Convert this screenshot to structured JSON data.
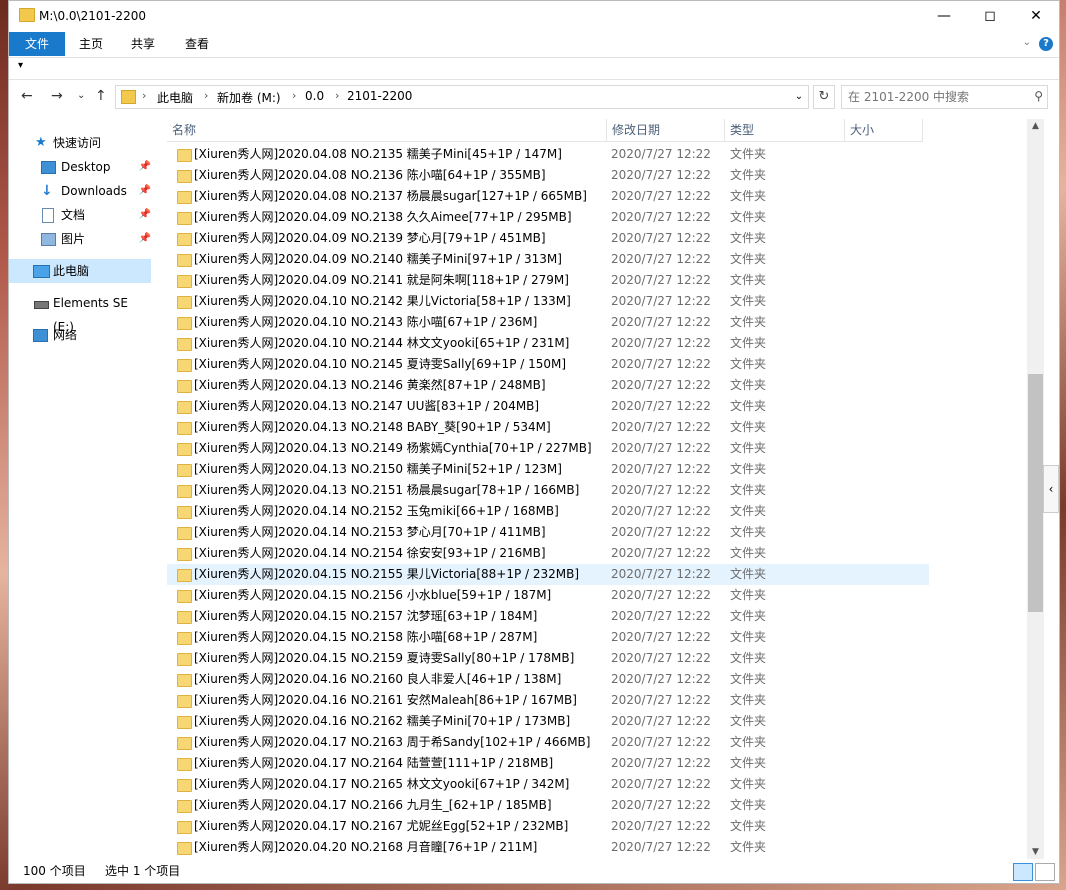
{
  "window": {
    "title": "M:\\0.0\\2101-2200"
  },
  "ribbon": {
    "tabs": [
      "文件",
      "主页",
      "共享",
      "查看"
    ]
  },
  "address": {
    "crumbs": [
      "此电脑",
      "新加卷 (M:)",
      "0.0",
      "2101-2200"
    ]
  },
  "search": {
    "placeholder": "在 2101-2200 中搜索"
  },
  "sidebar": {
    "items": [
      {
        "label": "快速访问",
        "icon": "star-icon"
      },
      {
        "label": "Desktop",
        "icon": "desktop-icon",
        "pinned": true
      },
      {
        "label": "Downloads",
        "icon": "download-icon",
        "pinned": true
      },
      {
        "label": "文档",
        "icon": "document-icon",
        "pinned": true
      },
      {
        "label": "图片",
        "icon": "picture-icon",
        "pinned": true
      },
      {
        "label": "此电脑",
        "icon": "computer-icon",
        "selected": true
      },
      {
        "label": "Elements SE (E:)",
        "icon": "drive-icon"
      },
      {
        "label": "网络",
        "icon": "network-icon"
      }
    ]
  },
  "columns": {
    "name": "名称",
    "date": "修改日期",
    "type": "类型",
    "size": "大小"
  },
  "files": [
    {
      "name": "[Xiuren秀人网]2020.04.08 NO.2135 糯美子Mini[45+1P / 147M]",
      "date": "2020/7/27 12:22",
      "type": "文件夹"
    },
    {
      "name": "[Xiuren秀人网]2020.04.08 NO.2136 陈小喵[64+1P / 355MB]",
      "date": "2020/7/27 12:22",
      "type": "文件夹"
    },
    {
      "name": "[Xiuren秀人网]2020.04.08 NO.2137 杨晨晨sugar[127+1P / 665MB]",
      "date": "2020/7/27 12:22",
      "type": "文件夹"
    },
    {
      "name": "[Xiuren秀人网]2020.04.09 NO.2138 久久Aimee[77+1P / 295MB]",
      "date": "2020/7/27 12:22",
      "type": "文件夹"
    },
    {
      "name": "[Xiuren秀人网]2020.04.09 NO.2139 梦心月[79+1P / 451MB]",
      "date": "2020/7/27 12:22",
      "type": "文件夹"
    },
    {
      "name": "[Xiuren秀人网]2020.04.09 NO.2140 糯美子Mini[97+1P / 313M]",
      "date": "2020/7/27 12:22",
      "type": "文件夹"
    },
    {
      "name": "[Xiuren秀人网]2020.04.09 NO.2141 就是阿朱啊[118+1P / 279M]",
      "date": "2020/7/27 12:22",
      "type": "文件夹"
    },
    {
      "name": "[Xiuren秀人网]2020.04.10 NO.2142 果儿Victoria[58+1P / 133M]",
      "date": "2020/7/27 12:22",
      "type": "文件夹"
    },
    {
      "name": "[Xiuren秀人网]2020.04.10 NO.2143 陈小喵[67+1P / 236M]",
      "date": "2020/7/27 12:22",
      "type": "文件夹"
    },
    {
      "name": "[Xiuren秀人网]2020.04.10 NO.2144 林文文yooki[65+1P / 231M]",
      "date": "2020/7/27 12:22",
      "type": "文件夹"
    },
    {
      "name": "[Xiuren秀人网]2020.04.10 NO.2145 夏诗雯Sally[69+1P / 150M]",
      "date": "2020/7/27 12:22",
      "type": "文件夹"
    },
    {
      "name": "[Xiuren秀人网]2020.04.13 NO.2146 黄楽然[87+1P / 248MB]",
      "date": "2020/7/27 12:22",
      "type": "文件夹"
    },
    {
      "name": "[Xiuren秀人网]2020.04.13 NO.2147 UU酱[83+1P / 204MB]",
      "date": "2020/7/27 12:22",
      "type": "文件夹"
    },
    {
      "name": "[Xiuren秀人网]2020.04.13 NO.2148 BABY_葵[90+1P / 534M]",
      "date": "2020/7/27 12:22",
      "type": "文件夹"
    },
    {
      "name": "[Xiuren秀人网]2020.04.13 NO.2149 杨紫嫣Cynthia[70+1P / 227MB]",
      "date": "2020/7/27 12:22",
      "type": "文件夹"
    },
    {
      "name": "[Xiuren秀人网]2020.04.13 NO.2150 糯美子Mini[52+1P / 123M]",
      "date": "2020/7/27 12:22",
      "type": "文件夹"
    },
    {
      "name": "[Xiuren秀人网]2020.04.13 NO.2151 杨晨晨sugar[78+1P / 166MB]",
      "date": "2020/7/27 12:22",
      "type": "文件夹"
    },
    {
      "name": "[Xiuren秀人网]2020.04.14 NO.2152 玉兔miki[66+1P / 168MB]",
      "date": "2020/7/27 12:22",
      "type": "文件夹"
    },
    {
      "name": "[Xiuren秀人网]2020.04.14 NO.2153 梦心月[70+1P / 411MB]",
      "date": "2020/7/27 12:22",
      "type": "文件夹"
    },
    {
      "name": "[Xiuren秀人网]2020.04.14 NO.2154 徐安安[93+1P / 216MB]",
      "date": "2020/7/27 12:22",
      "type": "文件夹"
    },
    {
      "name": "[Xiuren秀人网]2020.04.15 NO.2155 果儿Victoria[88+1P / 232MB]",
      "date": "2020/7/27 12:22",
      "type": "文件夹",
      "selected": true
    },
    {
      "name": "[Xiuren秀人网]2020.04.15 NO.2156 小水blue[59+1P / 187M]",
      "date": "2020/7/27 12:22",
      "type": "文件夹"
    },
    {
      "name": "[Xiuren秀人网]2020.04.15 NO.2157 沈梦瑶[63+1P / 184M]",
      "date": "2020/7/27 12:22",
      "type": "文件夹"
    },
    {
      "name": "[Xiuren秀人网]2020.04.15 NO.2158 陈小喵[68+1P / 287M]",
      "date": "2020/7/27 12:22",
      "type": "文件夹"
    },
    {
      "name": "[Xiuren秀人网]2020.04.15 NO.2159 夏诗雯Sally[80+1P / 178MB]",
      "date": "2020/7/27 12:22",
      "type": "文件夹"
    },
    {
      "name": "[Xiuren秀人网]2020.04.16 NO.2160 良人非爱人[46+1P / 138M]",
      "date": "2020/7/27 12:22",
      "type": "文件夹"
    },
    {
      "name": "[Xiuren秀人网]2020.04.16 NO.2161 安然Maleah[86+1P / 167MB]",
      "date": "2020/7/27 12:22",
      "type": "文件夹"
    },
    {
      "name": "[Xiuren秀人网]2020.04.16 NO.2162 糯美子Mini[70+1P / 173MB]",
      "date": "2020/7/27 12:22",
      "type": "文件夹"
    },
    {
      "name": "[Xiuren秀人网]2020.04.17 NO.2163 周于希Sandy[102+1P / 466MB]",
      "date": "2020/7/27 12:22",
      "type": "文件夹"
    },
    {
      "name": "[Xiuren秀人网]2020.04.17 NO.2164 陆萱萱[111+1P / 218MB]",
      "date": "2020/7/27 12:22",
      "type": "文件夹"
    },
    {
      "name": "[Xiuren秀人网]2020.04.17 NO.2165 林文文yooki[67+1P / 342M]",
      "date": "2020/7/27 12:22",
      "type": "文件夹"
    },
    {
      "name": "[Xiuren秀人网]2020.04.17 NO.2166 九月生_[62+1P / 185MB]",
      "date": "2020/7/27 12:22",
      "type": "文件夹"
    },
    {
      "name": "[Xiuren秀人网]2020.04.17 NO.2167 尤妮丝Egg[52+1P / 232MB]",
      "date": "2020/7/27 12:22",
      "type": "文件夹"
    },
    {
      "name": "[Xiuren秀人网]2020.04.20 NO.2168 月音瞳[76+1P / 211M]",
      "date": "2020/7/27 12:22",
      "type": "文件夹"
    }
  ],
  "status": {
    "count": "100 个项目",
    "selected": "选中 1 个项目"
  }
}
